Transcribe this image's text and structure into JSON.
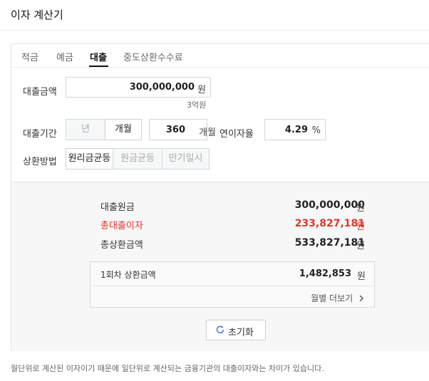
{
  "app": {
    "title": "이자 계산기"
  },
  "tabs": [
    {
      "label": "적금",
      "active": false
    },
    {
      "label": "예금",
      "active": false
    },
    {
      "label": "대출",
      "active": true
    },
    {
      "label": "중도상환수수료",
      "active": false
    }
  ],
  "form": {
    "loan_amount": {
      "label": "대출금액",
      "value": "300,000,000",
      "unit": "원",
      "readable": "3억원"
    },
    "loan_period": {
      "label": "대출기간",
      "unit_year": "년",
      "unit_month": "개월",
      "value": "360",
      "unit": "개월"
    },
    "interest_rate": {
      "label": "연이자율",
      "value": "4.29",
      "unit": "%"
    },
    "repayment_method": {
      "label": "상환방법",
      "options": [
        "원리금균등",
        "원금균등",
        "만기일시"
      ],
      "selected": "원리금균등"
    }
  },
  "results": {
    "principal": {
      "label": "대출원금",
      "value": "300,000,000",
      "unit": "원"
    },
    "total_interest": {
      "label": "총대출이자",
      "value": "233,827,181",
      "unit": "원",
      "color": "#e5322d"
    },
    "total_repayment": {
      "label": "총상환금액",
      "value": "533,827,181",
      "unit": "원"
    },
    "first_payment": {
      "label": "1회차 상환금액",
      "value": "1,482,853",
      "unit": "원"
    },
    "monthly_link": "월별 더보기"
  },
  "reset_button": "초기화",
  "footnote": "월단위로 계산된 이자이기 때문에 일단위로 계산되는 금융기관의 대출이자와는 차이가 있습니다."
}
